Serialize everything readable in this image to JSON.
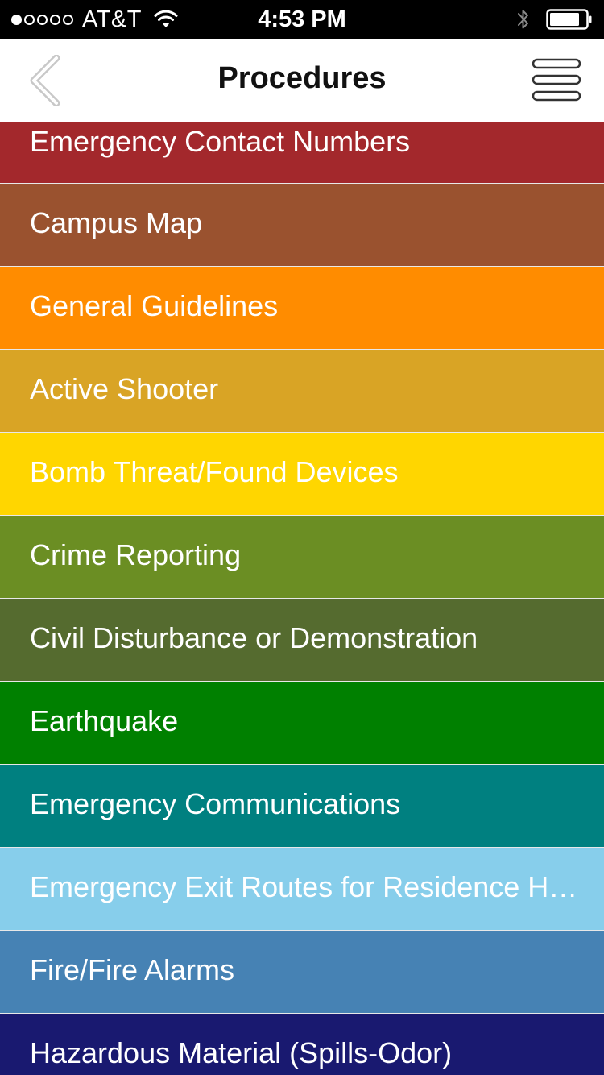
{
  "status_bar": {
    "carrier": "AT&T",
    "time": "4:53 PM",
    "signal_bars_filled": 1,
    "signal_bars_total": 5
  },
  "nav": {
    "title": "Procedures",
    "back_icon": "chevron-left-icon",
    "menu_icon": "hamburger-menu-icon"
  },
  "items": [
    {
      "label": "Emergency Contact Numbers",
      "color": "#a3282c"
    },
    {
      "label": "Campus Map",
      "color": "#9a522f"
    },
    {
      "label": "General Guidelines",
      "color": "#ff8c00"
    },
    {
      "label": "Active Shooter",
      "color": "#d9a425"
    },
    {
      "label": "Bomb Threat/Found Devices",
      "color": "#ffd600"
    },
    {
      "label": "Crime Reporting",
      "color": "#6b8e23"
    },
    {
      "label": "Civil Disturbance or Demonstration",
      "color": "#556b2f"
    },
    {
      "label": "Earthquake",
      "color": "#008000"
    },
    {
      "label": "Emergency Communications",
      "color": "#008080"
    },
    {
      "label": "Emergency Exit Routes for Residence Halls",
      "color": "#87ceeb"
    },
    {
      "label": "Fire/Fire Alarms",
      "color": "#4682b4"
    },
    {
      "label": "Hazardous Material (Spills-Odor)",
      "color": "#191970"
    }
  ]
}
